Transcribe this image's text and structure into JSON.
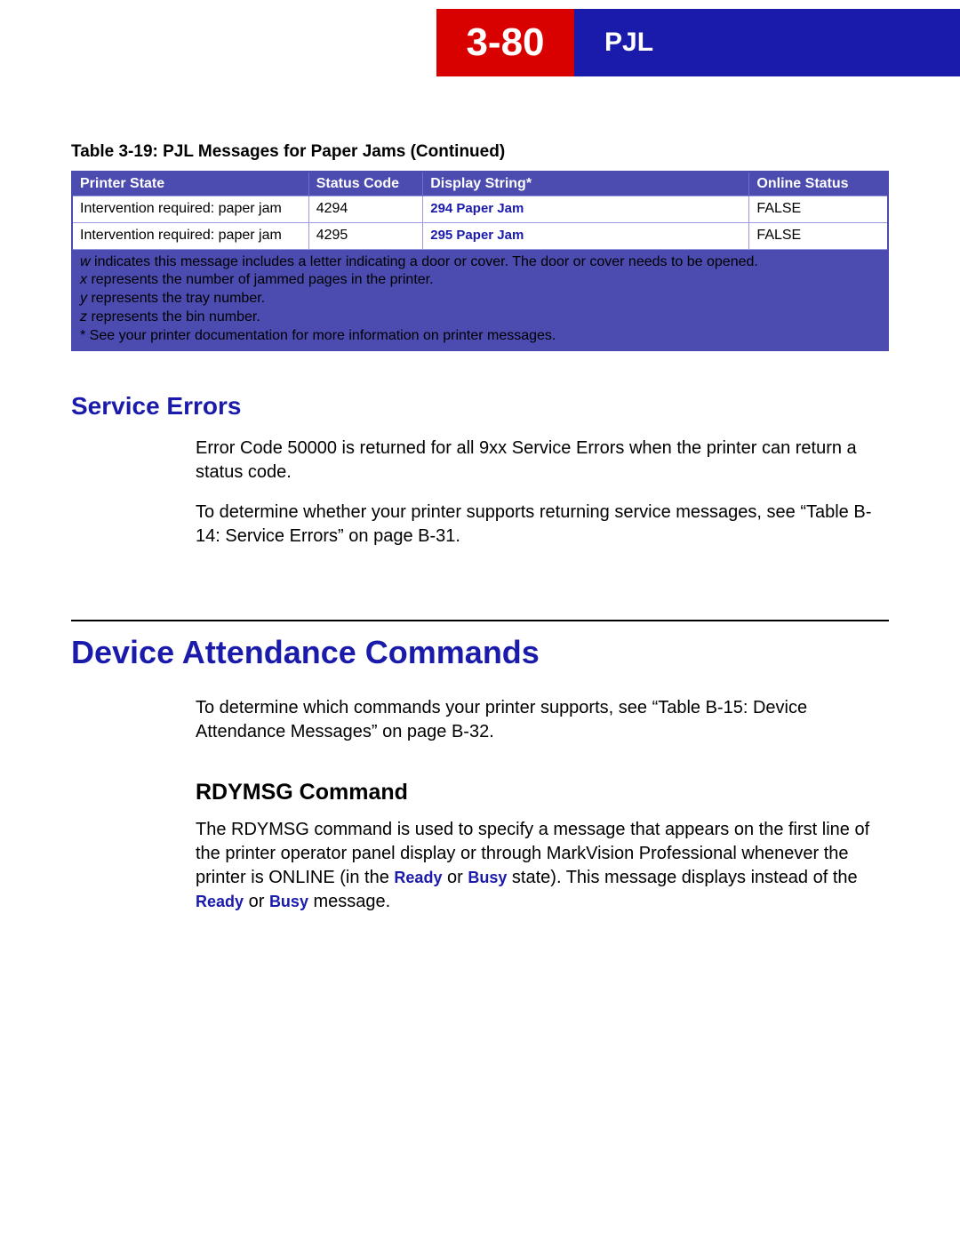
{
  "header": {
    "page_number": "3-80",
    "chapter": "PJL"
  },
  "table_caption": "Table 3-19:  PJL Messages for Paper Jams (Continued)",
  "table": {
    "headers": [
      "Printer State",
      "Status Code",
      "Display String*",
      "Online Status"
    ],
    "rows": [
      {
        "printer_state": "Intervention required: paper jam",
        "status_code": "4294",
        "display_string": "294 Paper Jam",
        "online_status": "FALSE"
      },
      {
        "printer_state": "Intervention required: paper jam",
        "status_code": "4295",
        "display_string": "295 Paper Jam",
        "online_status": "FALSE"
      }
    ],
    "legend": {
      "w_var": "w",
      "w_text": " indicates this message includes a letter indicating a door or cover. The door or cover needs to be opened.",
      "x_var": "x",
      "x_text": " represents the number of jammed pages in the printer.",
      "y_var": "y",
      "y_text": " represents the tray number.",
      "z_var": "z",
      "z_text": " represents the bin number.",
      "star": "* See your printer documentation for more information on printer messages."
    }
  },
  "service_errors": {
    "heading": "Service Errors",
    "p1": "Error Code 50000 is returned for all 9xx Service Errors when the printer can return a status code.",
    "p2": "To determine whether your printer supports returning service messages, see “Table B-14: Service Errors” on page B-31."
  },
  "device_attendance": {
    "heading": "Device Attendance Commands",
    "p1": "To determine which commands your printer supports, see “Table B-15: Device Attendance Messages” on page B-32."
  },
  "rdymsg": {
    "heading": "RDYMSG Command",
    "p1a": "The RDYMSG command is used to specify a message that appears on the first line of the printer operator panel display or through MarkVision Professional whenever the printer is ONLINE (in the ",
    "kw_ready": "Ready",
    "p1b": " or ",
    "kw_busy": "Busy",
    "p1c": " state). This message displays instead of the ",
    "p1d": " or ",
    "p1e": " message."
  }
}
